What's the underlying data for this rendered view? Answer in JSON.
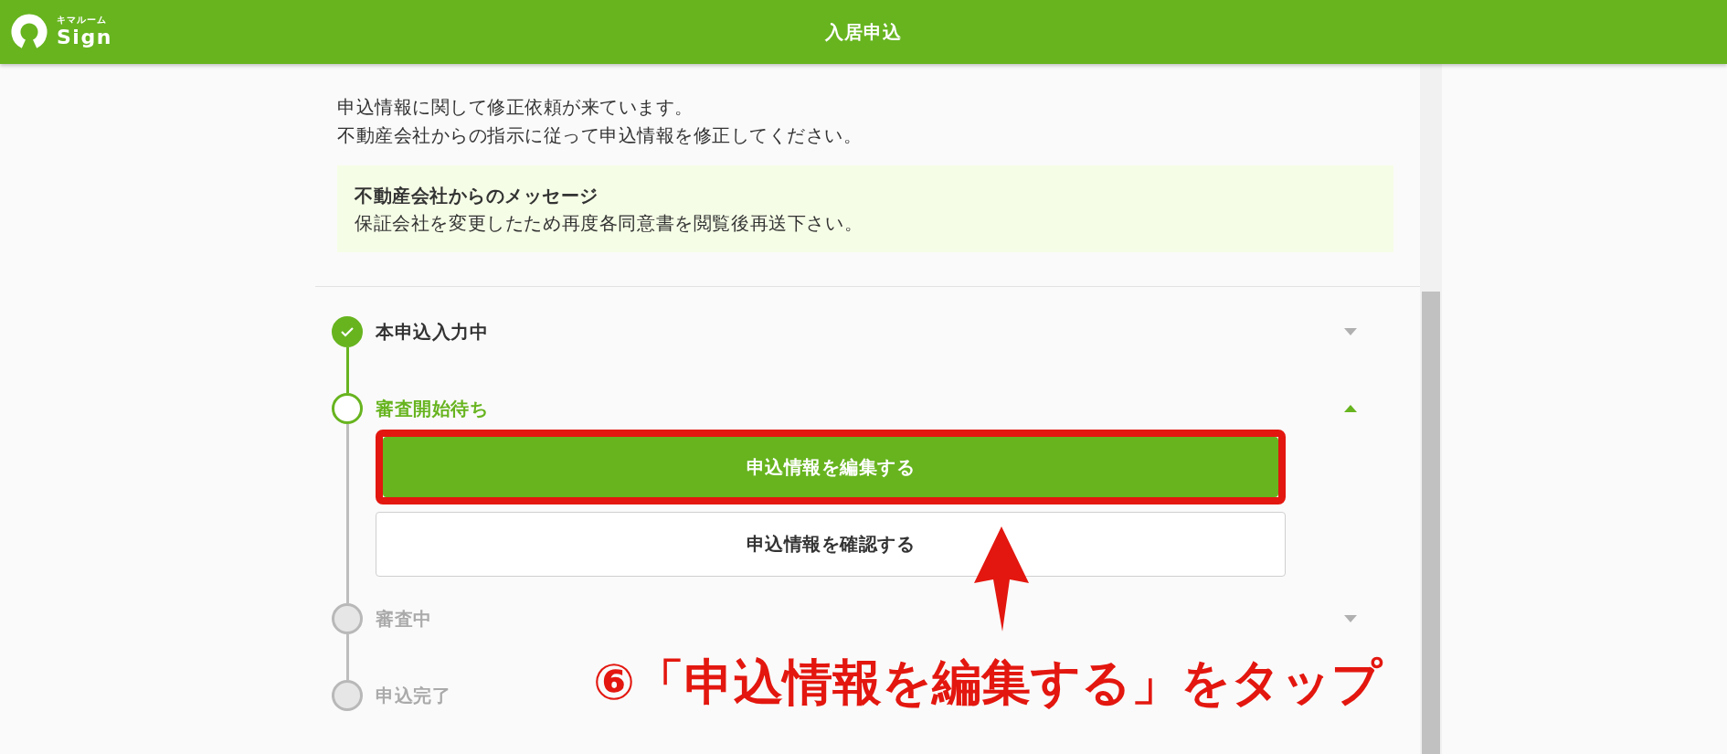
{
  "header": {
    "logo_caption": "キマルーム",
    "logo_name": "Sign",
    "title": "入居申込"
  },
  "notice": {
    "lines": [
      "申込情報に関して修正依頼が来ています。",
      "不動産会社からの指示に従って申込情報を修正してください。"
    ]
  },
  "message": {
    "title": "不動産会社からのメッセージ",
    "body": "保証会社を変更したため再度各同意書を閲覧後再送下さい。"
  },
  "steps": [
    {
      "label": "本申込入力中",
      "completed": true,
      "current": false,
      "expanded": false
    },
    {
      "label": "審査開始待ち",
      "completed": false,
      "current": true,
      "expanded": true,
      "actions": [
        {
          "label": "申込情報を編集する",
          "kind": "primary",
          "highlighted": true
        },
        {
          "label": "申込情報を確認する",
          "kind": "secondary",
          "highlighted": false
        }
      ]
    },
    {
      "label": "審査中",
      "completed": false,
      "current": false,
      "expanded": false
    },
    {
      "label": "申込完了",
      "completed": false,
      "current": false
    }
  ],
  "annotation": {
    "text": "⑥「申込情報を編集する」をタップ"
  }
}
